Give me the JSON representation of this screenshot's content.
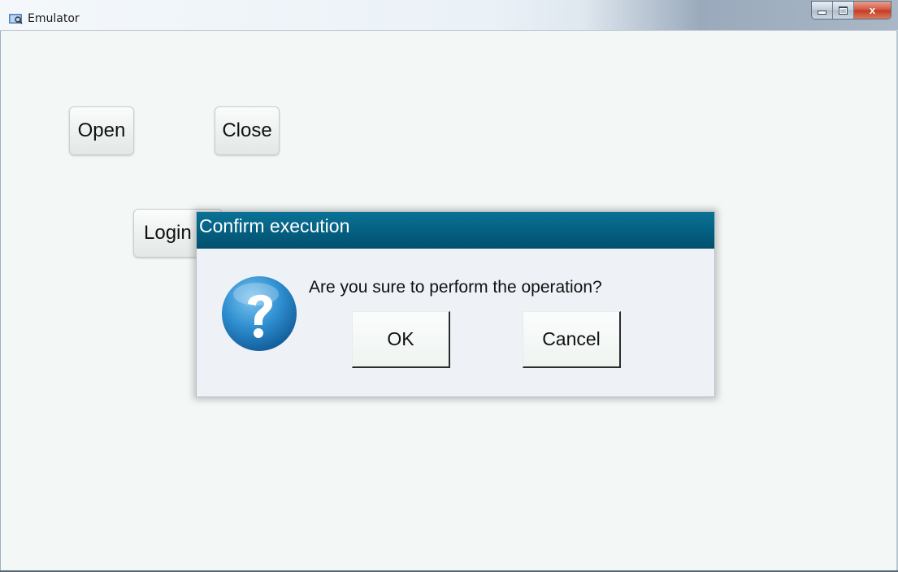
{
  "window": {
    "title": "Emulator",
    "icon": "magnifier-app-icon",
    "controls": {
      "minimize": "minimize-icon",
      "maximize": "maximize-icon",
      "close_glyph": "x"
    }
  },
  "buttons": {
    "open": "Open",
    "close": "Close",
    "login": "Login"
  },
  "dialog": {
    "title": "Confirm execution",
    "icon": "question-icon",
    "message": "Are you sure to perform the operation?",
    "ok": "OK",
    "cancel": "Cancel",
    "colors": {
      "title_bar": "#045d7f",
      "icon": "#2f8fd0"
    }
  }
}
